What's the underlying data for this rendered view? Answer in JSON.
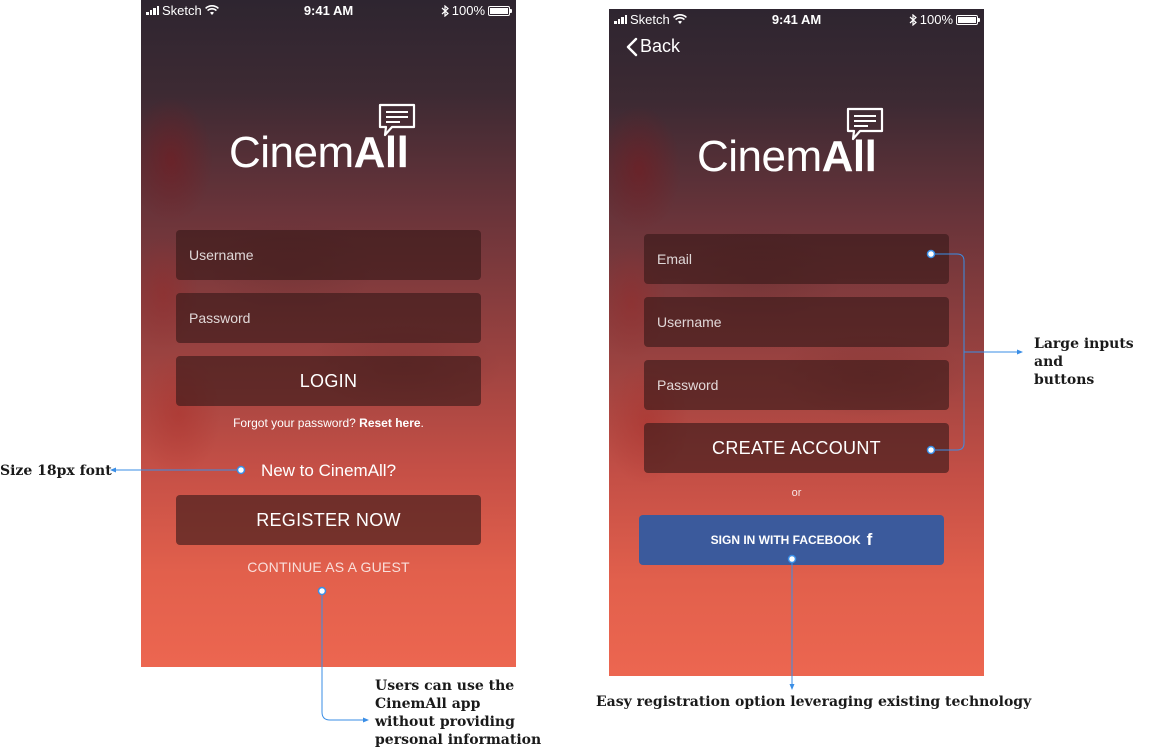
{
  "status_bar": {
    "carrier": "Sketch",
    "time": "9:41 AM",
    "battery": "100%",
    "battery_level": 1.0
  },
  "login_screen": {
    "logo_prefix": "Cinem",
    "logo_suffix": "All",
    "username_placeholder": "Username",
    "password_placeholder": "Password",
    "login_button": "LOGIN",
    "forgot_text": "Forgot your password?",
    "reset_link": "Reset here",
    "reset_period": ".",
    "new_to": "New to CinemAll?",
    "register_button": "REGISTER NOW",
    "guest_link": "CONTINUE AS A GUEST"
  },
  "register_screen": {
    "back_label": "Back",
    "logo_prefix": "Cinem",
    "logo_suffix": "All",
    "email_placeholder": "Email",
    "username_placeholder": "Username",
    "password_placeholder": "Password",
    "create_button": "CREATE ACCOUNT",
    "or_text": "or",
    "facebook_button": "SIGN IN WITH FACEBOOK",
    "facebook_glyph": "f"
  },
  "annotations": {
    "font_size": "Size 18px font",
    "guest": [
      "Users can use the",
      "CinemAll app",
      "without providing",
      "personal information"
    ],
    "large_inputs": [
      "Large inputs and",
      "buttons"
    ],
    "easy_registration": "Easy registration option leveraging existing technology"
  },
  "colors": {
    "accent_line": "#3a8ee6",
    "facebook": "#3b5a9c",
    "field_bg": "#37191999"
  },
  "icons": [
    "signal-icon",
    "wifi-icon",
    "bluetooth-icon",
    "battery-icon",
    "chat-bubble-icon",
    "back-chevron-icon",
    "facebook-icon"
  ]
}
